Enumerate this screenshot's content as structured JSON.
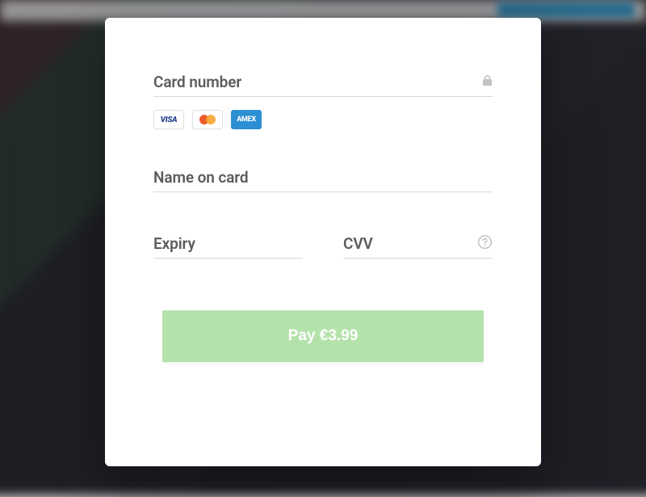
{
  "form": {
    "card_number": {
      "label": "Card number",
      "value": ""
    },
    "name_on_card": {
      "label": "Name on card",
      "value": ""
    },
    "expiry": {
      "label": "Expiry",
      "value": ""
    },
    "cvv": {
      "label": "CVV",
      "value": ""
    }
  },
  "card_brands": {
    "visa": "VISA",
    "mastercard": "mastercard",
    "amex": "AMEX"
  },
  "pay_button": {
    "label": "Pay €3.99"
  },
  "colors": {
    "pay_bg": "#b4e2ab",
    "text_muted": "#5c5c5c",
    "divider": "#d9d9d9"
  }
}
